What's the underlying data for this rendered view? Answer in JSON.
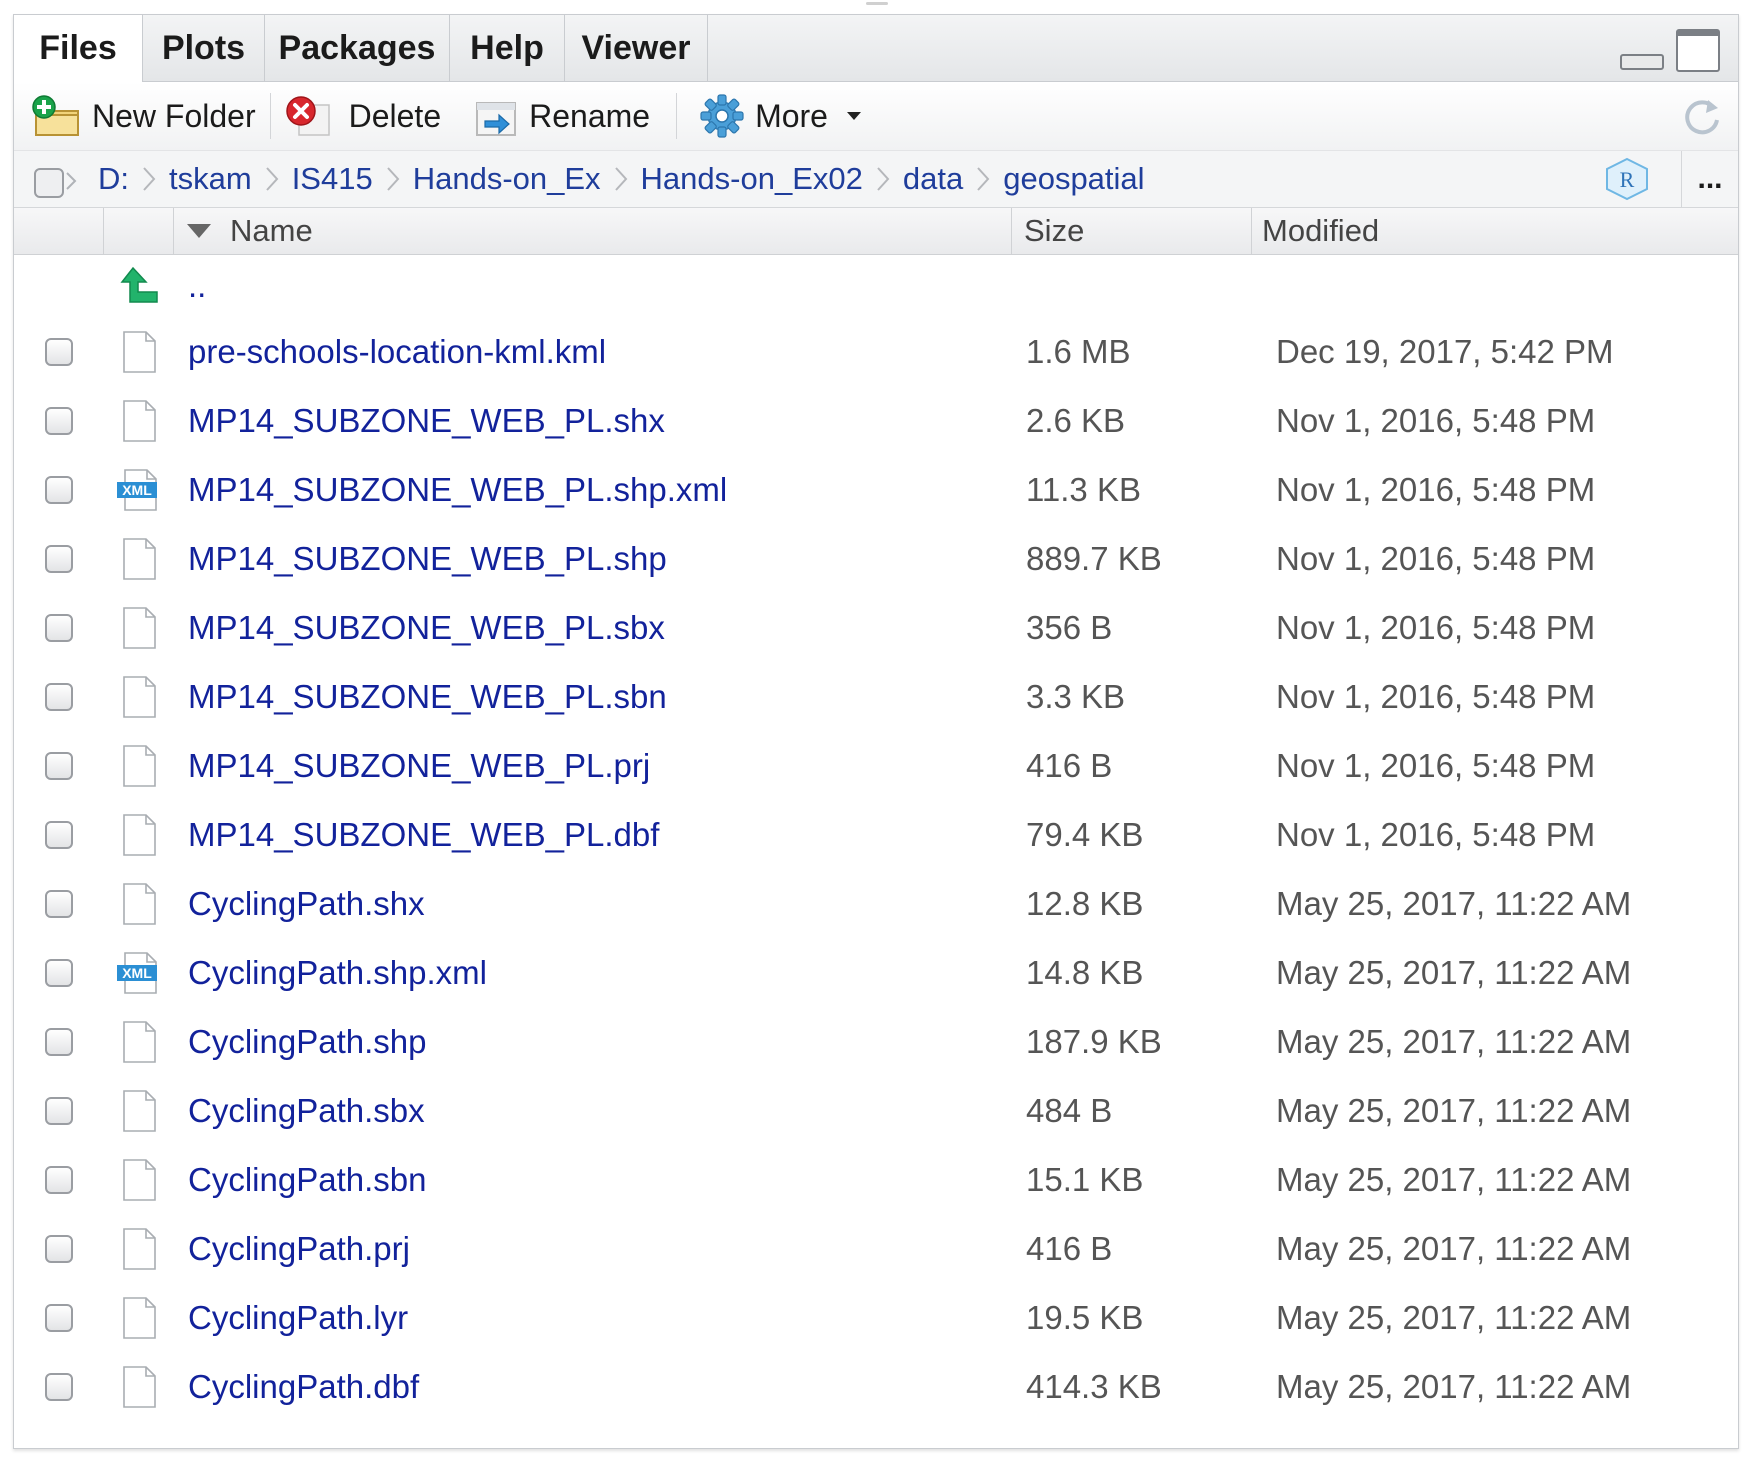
{
  "tabs": [
    {
      "label": "Files",
      "active": true
    },
    {
      "label": "Plots",
      "active": false
    },
    {
      "label": "Packages",
      "active": false
    },
    {
      "label": "Help",
      "active": false
    },
    {
      "label": "Viewer",
      "active": false
    }
  ],
  "toolbar": {
    "new_folder": "New Folder",
    "delete": "Delete",
    "rename": "Rename",
    "more": "More"
  },
  "breadcrumb": [
    "D:",
    "tskam",
    "IS415",
    "Hands-on_Ex",
    "Hands-on_Ex02",
    "data",
    "geospatial"
  ],
  "breadcrumb_more": "...",
  "columns": {
    "name": "Name",
    "size": "Size",
    "modified": "Modified"
  },
  "parent_dir": "..",
  "files": [
    {
      "name": "pre-schools-location-kml.kml",
      "size": "1.6 MB",
      "modified": "Dec 19, 2017, 5:42 PM",
      "icon": "file-icon"
    },
    {
      "name": "MP14_SUBZONE_WEB_PL.shx",
      "size": "2.6 KB",
      "modified": "Nov 1, 2016, 5:48 PM",
      "icon": "file-icon"
    },
    {
      "name": "MP14_SUBZONE_WEB_PL.shp.xml",
      "size": "11.3 KB",
      "modified": "Nov 1, 2016, 5:48 PM",
      "icon": "xml-file-icon"
    },
    {
      "name": "MP14_SUBZONE_WEB_PL.shp",
      "size": "889.7 KB",
      "modified": "Nov 1, 2016, 5:48 PM",
      "icon": "file-icon"
    },
    {
      "name": "MP14_SUBZONE_WEB_PL.sbx",
      "size": "356 B",
      "modified": "Nov 1, 2016, 5:48 PM",
      "icon": "file-icon"
    },
    {
      "name": "MP14_SUBZONE_WEB_PL.sbn",
      "size": "3.3 KB",
      "modified": "Nov 1, 2016, 5:48 PM",
      "icon": "file-icon"
    },
    {
      "name": "MP14_SUBZONE_WEB_PL.prj",
      "size": "416 B",
      "modified": "Nov 1, 2016, 5:48 PM",
      "icon": "file-icon"
    },
    {
      "name": "MP14_SUBZONE_WEB_PL.dbf",
      "size": "79.4 KB",
      "modified": "Nov 1, 2016, 5:48 PM",
      "icon": "file-icon"
    },
    {
      "name": "CyclingPath.shx",
      "size": "12.8 KB",
      "modified": "May 25, 2017, 11:22 AM",
      "icon": "file-icon"
    },
    {
      "name": "CyclingPath.shp.xml",
      "size": "14.8 KB",
      "modified": "May 25, 2017, 11:22 AM",
      "icon": "xml-file-icon"
    },
    {
      "name": "CyclingPath.shp",
      "size": "187.9 KB",
      "modified": "May 25, 2017, 11:22 AM",
      "icon": "file-icon"
    },
    {
      "name": "CyclingPath.sbx",
      "size": "484 B",
      "modified": "May 25, 2017, 11:22 AM",
      "icon": "file-icon"
    },
    {
      "name": "CyclingPath.sbn",
      "size": "15.1 KB",
      "modified": "May 25, 2017, 11:22 AM",
      "icon": "file-icon"
    },
    {
      "name": "CyclingPath.prj",
      "size": "416 B",
      "modified": "May 25, 2017, 11:22 AM",
      "icon": "file-icon"
    },
    {
      "name": "CyclingPath.lyr",
      "size": "19.5 KB",
      "modified": "May 25, 2017, 11:22 AM",
      "icon": "file-icon"
    },
    {
      "name": "CyclingPath.dbf",
      "size": "414.3 KB",
      "modified": "May 25, 2017, 11:22 AM",
      "icon": "file-icon"
    }
  ],
  "colors": {
    "link": "#12229b",
    "crumb": "#1f3d9b",
    "secondary_text": "#555555",
    "xml_badge": "#2b8fd4",
    "up_arrow": "#22b36b"
  }
}
